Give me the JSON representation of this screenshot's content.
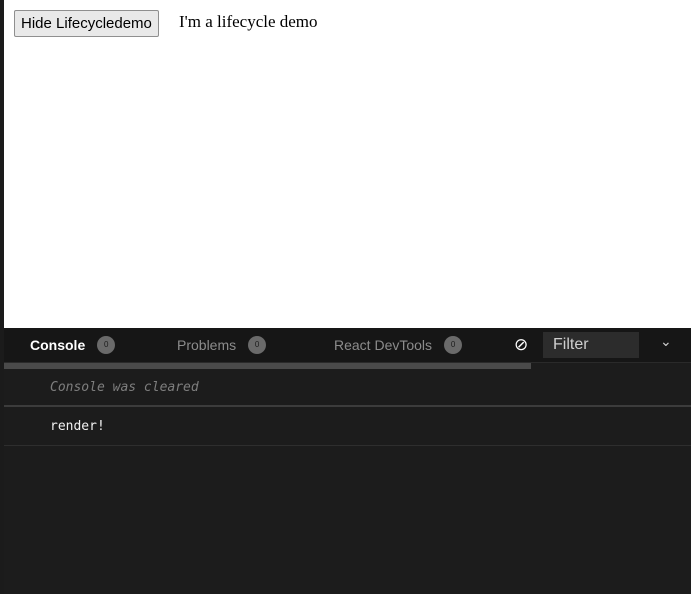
{
  "preview": {
    "hide_button_label": "Hide Lifecycledemo",
    "demo_text": "I'm a lifecycle demo"
  },
  "devtools": {
    "tabs": [
      {
        "label": "Console",
        "badge": "0",
        "active": true
      },
      {
        "label": "Problems",
        "badge": "0",
        "active": false
      },
      {
        "label": "React DevTools",
        "badge": "0",
        "active": false
      }
    ],
    "clear_icon": "clear-console-icon",
    "filter_placeholder": "Filter",
    "dropdown_icon": "chevron-down-icon",
    "console_lines": [
      {
        "text": "Console was cleared",
        "kind": "info"
      },
      {
        "text": "render!",
        "kind": "log"
      }
    ]
  }
}
